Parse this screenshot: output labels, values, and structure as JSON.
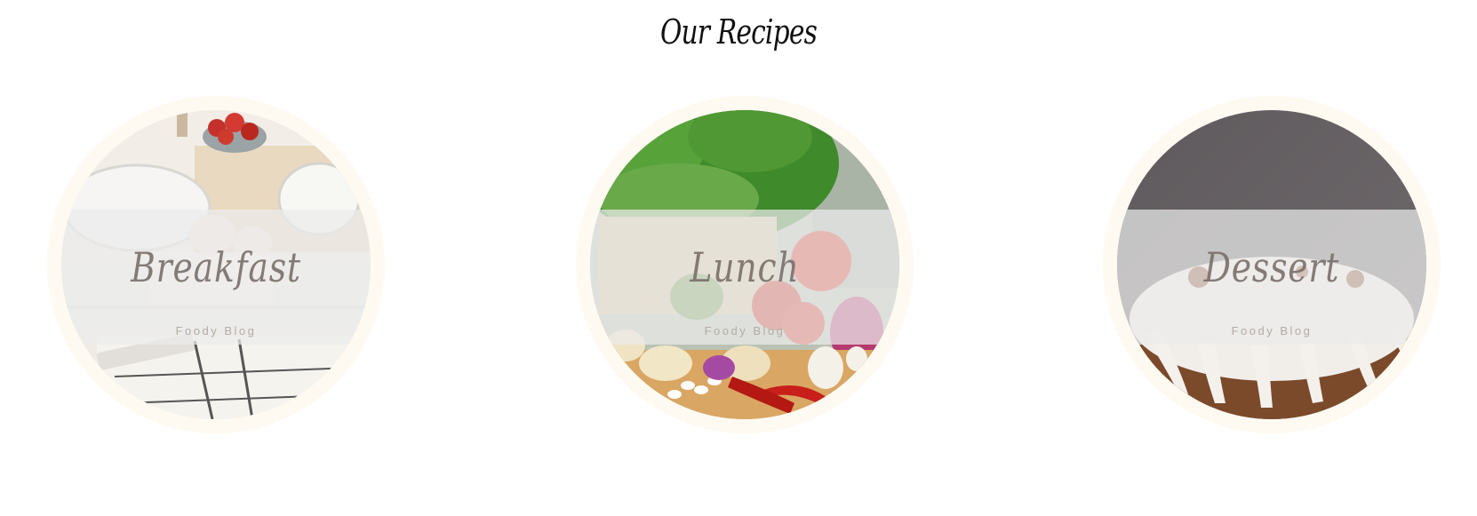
{
  "section": {
    "title": "Our Recipes"
  },
  "cards": [
    {
      "name": "Breakfast",
      "subtitle": "Foody Blog",
      "image": "breakfast-table-photo"
    },
    {
      "name": "Lunch",
      "subtitle": "Foody Blog",
      "image": "vegetables-photo"
    },
    {
      "name": "Dessert",
      "subtitle": "Foody Blog",
      "image": "bundt-cake-photo"
    }
  ],
  "colors": {
    "card_ring": "#fffaf1",
    "band_overlay": "#ececec",
    "card_title": "#7a6f6a",
    "card_subtitle": "#b3aba4",
    "heading": "#111111"
  }
}
